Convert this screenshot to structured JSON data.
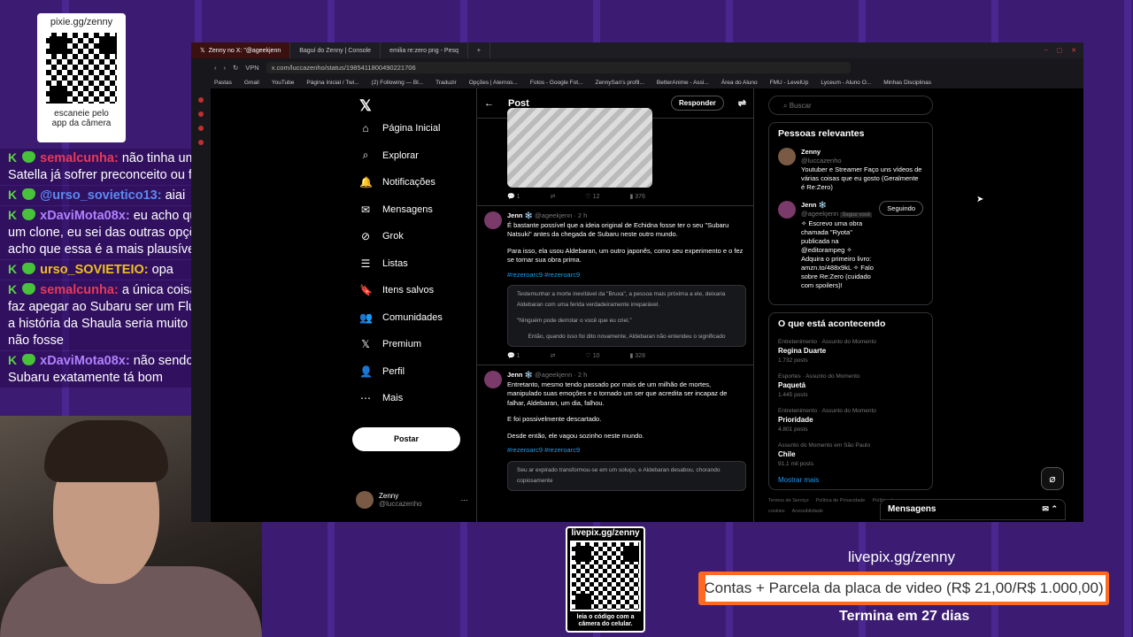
{
  "overlay": {
    "qr_title": "pixie.gg/zenny",
    "qr_caption_1": "escaneie pelo",
    "qr_caption_2": "app da câmera",
    "chat": [
      {
        "user": "semalcunha:",
        "text": "não tinha um treco da Satella já sofrer preconceito ou fumei?",
        "color": "#e8385a"
      },
      {
        "user": "@urso_sovietico13:",
        "text": "aiai",
        "color": "#5a8af0"
      },
      {
        "user": "xDaviMota08x:",
        "text": "eu acho que o AI é um clone, eu sei das outras opções mas acho que essa é a mais plausível",
        "color": "#b080ff"
      },
      {
        "user": "urso_SOVIETEIO:",
        "text": "opa",
        "color": "#f0c020"
      },
      {
        "user": "semalcunha:",
        "text": "a única coisa que me faz apegar ao Subaru ser um Flugel é que a história da Shaula seria muito trágica se não fosse",
        "color": "#e8385a"
      },
      {
        "user": "xDaviMota08x:",
        "text": "não sendo o Subaru exatamente tá bom",
        "color": "#b080ff"
      }
    ],
    "livepix_qr_title": "livepix.gg/zenny",
    "livepix_qr_caption_1": "leia o código com a",
    "livepix_qr_caption_2": "câmera do celular.",
    "livepix_link": "livepix.gg/zenny",
    "goal": "Contas + Parcela da placa de video (R$ 21,00/R$ 1.000,00)",
    "ends": "Termina em 27 dias"
  },
  "browser": {
    "tabs": [
      {
        "label": "Zenny no X: \"@ageekjenn",
        "active": true
      },
      {
        "label": "Baguí do Zenny | Console"
      },
      {
        "label": "emilia re:zero png - Pesq"
      }
    ],
    "url": "x.com/luccazenho/status/1985411800490221706",
    "vpn": "VPN",
    "bookmarks": [
      "Pastas",
      "Gmail",
      "YouTube",
      "Página Inicial / Twi...",
      "(2) Following — Bl...",
      "Traduzir",
      "Opções | Aternos...",
      "Fotos - Google Fot...",
      "ZennySan's profil...",
      "BetterAnime - Assi...",
      "Área do Aluno",
      "FMU - LevelUp",
      "Lyceum - Aluno O...",
      "Minhas Disciplinas"
    ]
  },
  "x": {
    "nav": [
      "Página Inicial",
      "Explorar",
      "Notificações",
      "Mensagens",
      "Grok",
      "Listas",
      "Itens salvos",
      "Comunidades",
      "Premium",
      "Perfil",
      "Mais"
    ],
    "post_button": "Postar",
    "me_name": "Zenny",
    "me_handle": "@luccazenho",
    "header": "Post",
    "reply": "Responder",
    "first_actions": [
      "1",
      "",
      "12",
      "376"
    ],
    "tweets": [
      {
        "name": "Jenn ❄️",
        "handle": "@ageekjenn · 2 h",
        "text1": "É bastante possível que a ideia original de Echidna fosse ter o seu \"Subaru Natsuki\" antes da chegada de Subaru neste outro mundo.",
        "text2": "Para isso, ela usou Aldebaran, um outro japonês, como seu experimento e o fez se tornar sua obra prima.",
        "tags": "#rezeroarc9 #rezeroarc9",
        "quote1": "Testemunhar a morte inevitável da \"Bruxa\", a pessoa mais próxima a ele, deixaria Aldebaran com uma ferida verdadeiramente irreparável.",
        "quote2": "\"Ninguém pode derrotar o você que eu criei.\"",
        "quote3": "Então, quando isso foi dito novamente, Aldebaran não entendeu o significado",
        "actions": [
          "1",
          "",
          "10",
          "328"
        ]
      },
      {
        "name": "Jenn ❄️",
        "handle": "@ageekjenn · 2 h",
        "text1": "Entretanto, mesmo tendo passado por mais de um milhão de mortes, manipulado suas emoções e o tornado um ser que acredita ser incapaz de falhar, Aldebaran, um dia, falhou.",
        "text2": "E foi possivelmente descartado.",
        "text3": "Desde então, ele vagou sozinho neste mundo.",
        "tags": "#rezeroarc9 #rezeroarc9",
        "quote1": "Seu ar expirado transformou-se em um soluço, e Aldebaran desabou, chorando copiosamente"
      }
    ],
    "search": "Buscar",
    "relevant_title": "Pessoas relevantes",
    "people": [
      {
        "name": "Zenny",
        "handle": "@luccazenho",
        "bio": "Youtuber e Streamer Faço uns vídeos de várias coisas que eu gosto (Geralmente é Re:Zero)"
      },
      {
        "name": "Jenn ❄️",
        "handle": "@ageekjenn",
        "badge": "Segue você",
        "button": "Seguindo",
        "bio": "✧ Escrevo uma obra chamada \"Ryota\" publicada na @editorampeg ✧ Adquira o primeiro livro: amzn.to/488x9kL ✧ Falo sobre Re:Zero (cuidado com spoilers)!"
      }
    ],
    "trending_title": "O que está acontecendo",
    "trends": [
      {
        "cat": "Entretenimento · Assunto do Momento",
        "name": "Regina Duarte",
        "count": "1.732 posts"
      },
      {
        "cat": "Esportes · Assunto do Momento",
        "name": "Paquetá",
        "count": "1.445 posts"
      },
      {
        "cat": "Entretenimento · Assunto do Momento",
        "name": "Prioridade",
        "count": "4.801 posts"
      },
      {
        "cat": "Assunto do Momento em São Paulo",
        "name": "Chile",
        "count": "91,1 mil posts"
      }
    ],
    "show_more": "Mostrar mais",
    "footer": [
      "Termos de Serviço",
      "Política de Privacidade",
      "Política de cookies",
      "Acessibilidade"
    ],
    "messages": "Mensagens"
  }
}
